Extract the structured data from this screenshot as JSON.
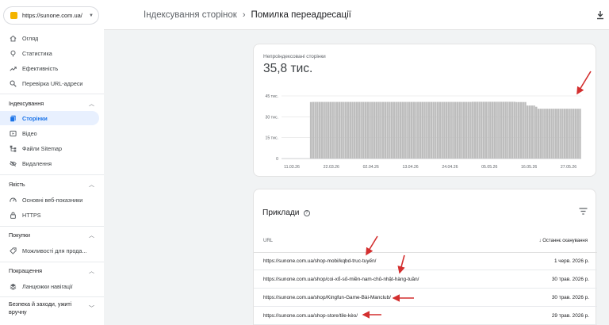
{
  "property": {
    "url": "https://sunone.com.ua/"
  },
  "breadcrumb": {
    "parent": "Індексування сторінок",
    "current": "Помилка переадресації"
  },
  "sidebar": {
    "top_items": [
      {
        "label": "Огляд",
        "icon": "home-icon"
      },
      {
        "label": "Статистика",
        "icon": "performance-icon"
      },
      {
        "label": "Ефективність",
        "icon": "trending-icon"
      },
      {
        "label": "Перевірка URL-адреси",
        "icon": "search-icon"
      }
    ],
    "sections": [
      {
        "title": "Індексування",
        "items": [
          {
            "label": "Сторінки",
            "icon": "pages-icon",
            "active": true
          },
          {
            "label": "Відео",
            "icon": "video-icon"
          },
          {
            "label": "Файли Sitemap",
            "icon": "sitemap-icon"
          },
          {
            "label": "Видалення",
            "icon": "removal-icon"
          }
        ]
      },
      {
        "title": "Якість",
        "items": [
          {
            "label": "Основні веб-показники",
            "icon": "gauge-icon"
          },
          {
            "label": "HTTPS",
            "icon": "lock-icon"
          }
        ]
      },
      {
        "title": "Покупки",
        "items": [
          {
            "label": "Можливості для прода...",
            "icon": "tag-icon"
          }
        ]
      },
      {
        "title": "Покращення",
        "items": [
          {
            "label": "Ланцюжки навігації",
            "icon": "layers-icon"
          }
        ]
      },
      {
        "title": "Безпека й заходи, ужиті вручну",
        "items": []
      }
    ]
  },
  "summary": {
    "label": "Непроіндексовані сторінки",
    "value": "35,8 тис."
  },
  "chart_data": {
    "type": "bar",
    "title": "",
    "xlabel": "",
    "ylabel": "",
    "ylim": [
      0,
      45000
    ],
    "yticks": [
      "0",
      "15 тис.",
      "30 тис.",
      "45 тис."
    ],
    "yticks_values": [
      0,
      15000,
      30000,
      45000
    ],
    "xticks": [
      "11.03.26",
      "22.03.26",
      "02.04.26",
      "13.04.26",
      "24.04.26",
      "05.05.26",
      "16.05.26",
      "27.05.26"
    ],
    "bar_color": "#bdbdbd",
    "series": [
      {
        "values": [
          0,
          0,
          0,
          0,
          0,
          0,
          0,
          0,
          0,
          0,
          0,
          0,
          0,
          40600,
          40700,
          40700,
          40700,
          40700,
          40700,
          40700,
          40700,
          40700,
          40700,
          40700,
          40700,
          40700,
          40700,
          40700,
          40700,
          40700,
          40700,
          40700,
          40700,
          40700,
          40700,
          40700,
          40700,
          40700,
          40700,
          40700,
          40700,
          40700,
          40700,
          40700,
          40700,
          40700,
          40700,
          40700,
          40700,
          40700,
          40700,
          40700,
          40700,
          40700,
          40700,
          40700,
          40700,
          40700,
          40700,
          40700,
          40700,
          40700,
          40700,
          40700,
          40700,
          40700,
          40700,
          40700,
          40700,
          40700,
          40700,
          40700,
          40700,
          40700,
          40700,
          40700,
          40700,
          40700,
          40700,
          40700,
          40700,
          40700,
          40700,
          40700,
          40700,
          40700,
          40700,
          40800,
          40800,
          40800,
          40800,
          40800,
          40800,
          40800,
          40800,
          40800,
          40800,
          40800,
          40800,
          40800,
          40800,
          40800,
          40800,
          40800,
          40800,
          40800,
          40800,
          40600,
          40600,
          40600,
          40600,
          40600,
          38100,
          38100,
          38100,
          38100,
          37200,
          35800,
          35800,
          35800,
          35800,
          35800,
          35800,
          35800,
          35800,
          35800,
          35800,
          35800,
          35800,
          35800,
          35800,
          35800,
          35800,
          35800,
          35800,
          35800,
          35800
        ]
      }
    ]
  },
  "examples": {
    "title": "Приклади",
    "col_url": "URL",
    "col_crawl": "Останнє сканування",
    "rows": [
      {
        "url": "https://sunone.com.ua/shop-mobi/kqbd-truc-tuyến/",
        "date": "1 черв. 2026 р."
      },
      {
        "url": "https://sunone.com.ua/shop/coi-xổ-số-miền-nam-chủ-nhật-hàng-tuần/",
        "date": "30 трав. 2026 р."
      },
      {
        "url": "https://sunone.com.ua/shop/Kingfun-Game-Bài-Manclub/",
        "date": "30 трав. 2026 р."
      },
      {
        "url": "https://sunone.com.ua/shop-store/tile-kèo/",
        "date": "29 трав. 2026 р."
      }
    ]
  },
  "colors": {
    "accent": "#1a73e8",
    "active_bg": "#e8f0fe",
    "annotation": "#d32f2f",
    "bar": "#bdbdbd"
  }
}
